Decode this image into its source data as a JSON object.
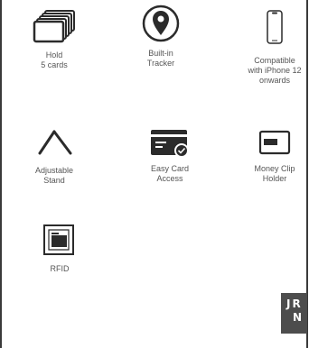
{
  "features": [
    {
      "icon": "card-stack-icon",
      "lines": [
        "Hold",
        "5 cards"
      ]
    },
    {
      "icon": "location-pin-icon",
      "lines": [
        "Built-in",
        "Tracker"
      ]
    },
    {
      "icon": "smartphone-icon",
      "lines": [
        "Compatible",
        "with iPhone 12",
        "onwards"
      ]
    },
    {
      "icon": "stand-icon",
      "lines": [
        "Adjustable",
        "Stand"
      ]
    },
    {
      "icon": "card-access-icon",
      "lines": [
        "Easy Card",
        "Access"
      ]
    },
    {
      "icon": "money-clip-icon",
      "lines": [
        "Money Clip",
        "Holder"
      ]
    },
    {
      "icon": "rfid-icon",
      "lines": [
        "RFID"
      ]
    }
  ],
  "badge": {
    "line1": "JR",
    "line2": "N"
  }
}
